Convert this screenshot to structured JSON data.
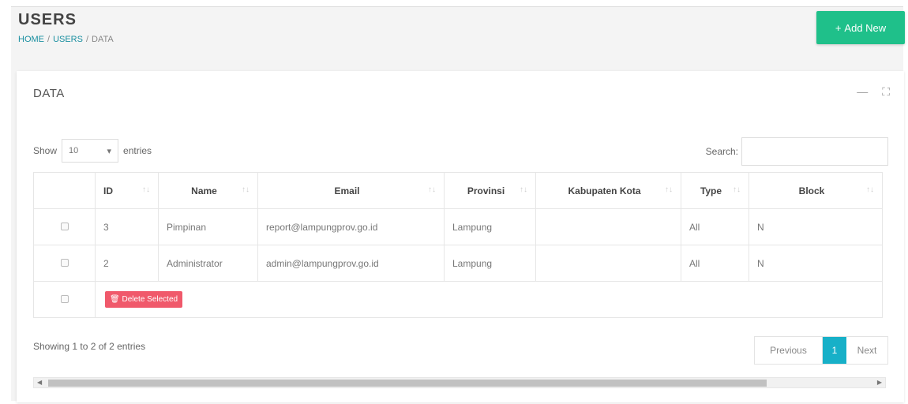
{
  "header": {
    "title": "USERS",
    "breadcrumb": [
      "HOME",
      "USERS",
      "DATA"
    ],
    "add_button": "Add New",
    "add_icon": "plus-icon"
  },
  "card": {
    "title": "DATA",
    "tools": [
      "minimize-icon",
      "fullscreen-icon"
    ]
  },
  "table_controls": {
    "show_label": "Show",
    "entries_value": "10",
    "entries_label": "entries",
    "search_label": "Search:",
    "search_value": ""
  },
  "table": {
    "columns": [
      "",
      "ID",
      "Name",
      "Email",
      "Provinsi",
      "Kabupaten Kota",
      "Type",
      "Block"
    ],
    "rows": [
      {
        "id": "3",
        "name": "Pimpinan",
        "email": "report@lampungprov.go.id",
        "provinsi": "Lampung",
        "kabupaten": "",
        "type": "All",
        "block": "N"
      },
      {
        "id": "2",
        "name": "Administrator",
        "email": "admin@lampungprov.go.id",
        "provinsi": "Lampung",
        "kabupaten": "",
        "type": "All",
        "block": "N"
      }
    ],
    "delete_button": "Delete Selected"
  },
  "footer": {
    "info": "Showing 1 to 2 of 2 entries",
    "previous": "Previous",
    "page": "1",
    "next": "Next"
  },
  "colors": {
    "accent": "#1fc08a",
    "active_page": "#17b0c8",
    "danger": "#f0596b",
    "link": "#1a8fa0"
  }
}
